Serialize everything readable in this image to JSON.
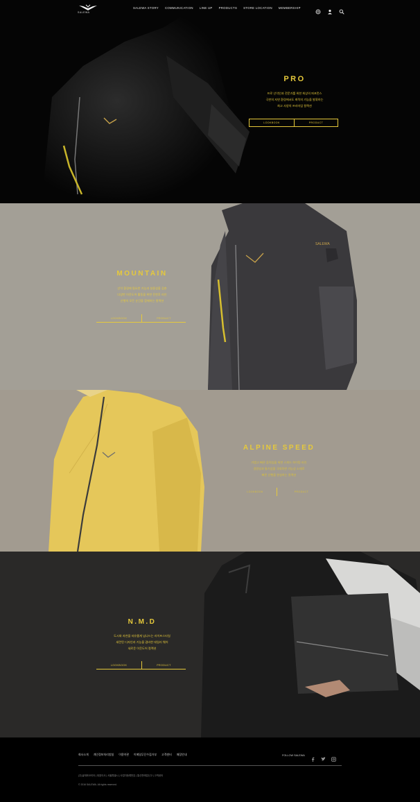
{
  "header": {
    "logo_text": "SALEWA",
    "logo_sub": "MOUNTAIN SPORTS",
    "nav": [
      {
        "label": "SALEWA STORY"
      },
      {
        "label": "COMMUNICATION"
      },
      {
        "label": "LINE UP"
      },
      {
        "label": "PRODUCTS"
      },
      {
        "label": "STORE LOCATION"
      },
      {
        "label": "MEMBERSHIP"
      }
    ],
    "icons": [
      "globe-icon",
      "user-icon",
      "search-icon"
    ]
  },
  "sections": [
    {
      "title": "PRO",
      "desc": [
        "프로 산악인과 전문가를 위한 최상의 퍼포먼스",
        "극한의 자연 환경에서도 최적의 기능을 발휘하는",
        "최고 사양의 프리미엄 컬렉션"
      ],
      "buttons": [
        "LOOKBOOK",
        "PRODUCT"
      ]
    },
    {
      "title": "MOUNTAIN",
      "desc": [
        "산악 환경에 필요한 기능과 실용성을 갖춘",
        "다양한 아웃도어 활동을 위한 전천후 라인",
        "산행의 모든 순간을 함께하는 컬렉션"
      ],
      "buttons": [
        "LOOKBOOK",
        "PRODUCT"
      ]
    },
    {
      "title": "ALPINE SPEED",
      "desc": [
        "가볍고 빠른 움직임을 위한 스피드 하이킹 라인",
        "경량성과 통기성을 극대화한 기능성 소재로",
        "빠른 산행을 완성하는 컬렉션"
      ],
      "buttons": [
        "LOOKBOOK",
        "PRODUCT"
      ]
    },
    {
      "title": "N.M.D",
      "desc": [
        "도시와 자연을 자유롭게 넘나드는 라이프스타일",
        "세련된 디자인과 기능을 겸비한 데일리 웨어",
        "새로운 아웃도어 컬렉션"
      ],
      "buttons": [
        "LOOKBOOK",
        "PRODUCT"
      ]
    }
  ],
  "footer": {
    "links": [
      "회사소개",
      "개인정보처리방침",
      "이용약관",
      "이메일무단수집거부",
      "고객센터",
      "매장안내"
    ],
    "follow_label": "FOLLOW SALEWA",
    "social": [
      "facebook-icon",
      "twitter-icon",
      "instagram-icon"
    ],
    "info": "(주)살레와코리아 | 대표이사 | 서울특별시 | 사업자등록번호 | 통신판매업신고 | 고객센터",
    "copyright": "© 2016 SALEWA. All rights reserved."
  },
  "colors": {
    "accent": "#e6c93b",
    "pro_bg": "#050505",
    "mountain_bg": "#a39f96",
    "alpine_bg": "#a29b90",
    "nmd_bg": "#2a2928",
    "footer_bg": "#000000"
  }
}
